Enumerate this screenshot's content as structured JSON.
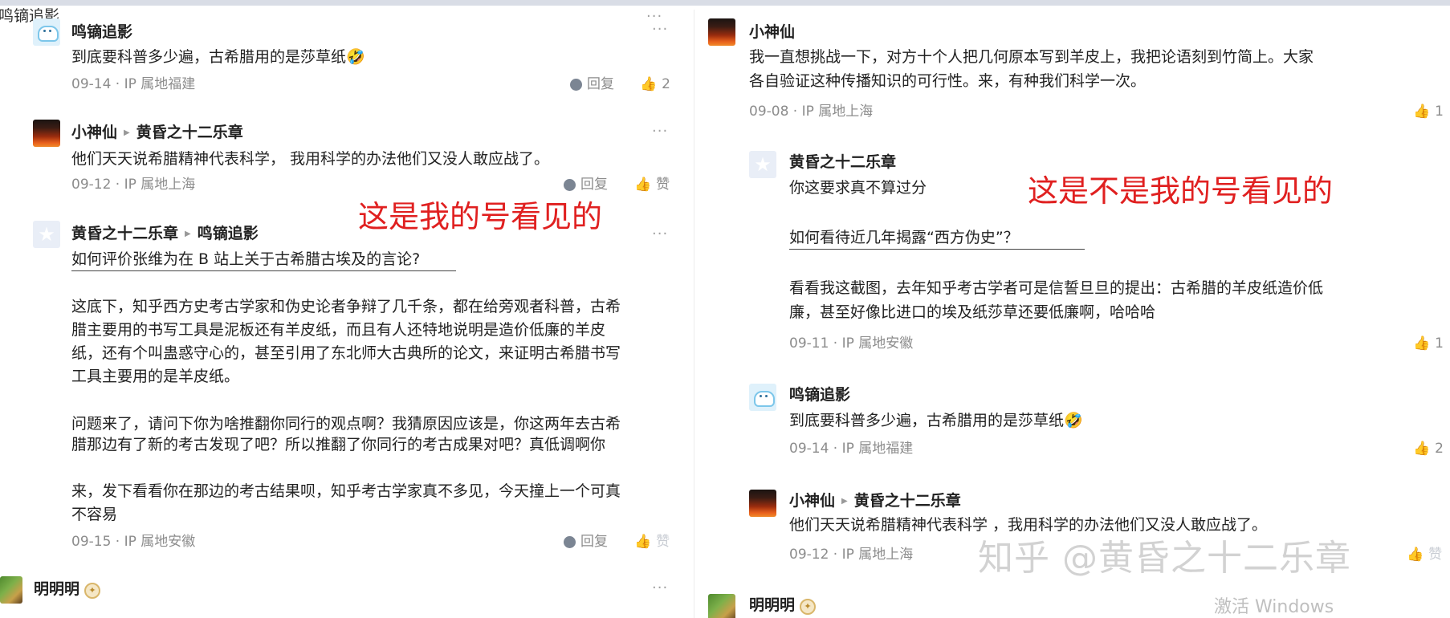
{
  "annotations": {
    "left": "这是我的号看见的",
    "right": "这是不是我的号看见的"
  },
  "watermark": "知乎 @黄昏之十二乐章",
  "windows_activate": "激活 Windows",
  "actions": {
    "reply": "回复",
    "like": "赞"
  },
  "left_panel": {
    "clipped_top_name": "鸣镝追影",
    "comments": [
      {
        "author": "鸣镝追影",
        "text": "到底要科普多少遍，古希腊用的是莎草纸🤣",
        "meta": "09-14 · IP 属地福建",
        "likes": "2"
      },
      {
        "author": "小神仙",
        "reply_to": "黄昏之十二乐章",
        "text": "他们天天说希腊精神代表科学， 我用科学的办法他们又没人敢应战了。",
        "meta": "09-12 · IP 属地上海"
      },
      {
        "author": "黄昏之十二乐章",
        "reply_to": "鸣镝追影",
        "link": "如何评价张维为在 B 站上关于古希腊古埃及的言论?",
        "paragraphs": [
          "这底下，知乎西方史考古学家和伪史论者争辩了几千条，都在给旁观者科普，古希",
          "腊主要用的书写工具是泥板还有羊皮纸，而且有人还特地说明是造价低廉的羊皮",
          "纸，还有个叫蛊惑守心的，甚至引用了东北师大古典所的论文，来证明古希腊书写",
          "工具主要用的是羊皮纸。",
          "问题来了，请问下你为啥推翻你同行的观点啊？我猜原因应该是，你这两年去古希",
          "腊那边有了新的考古发现了吧？所以推翻了你同行的考古成果对吧？真低调啊你",
          "来，发下看看你在那边的考古结果呗，知乎考古学家真不多见，今天撞上一个可真",
          "不容易"
        ],
        "meta": "09-15 · IP 属地安徽"
      },
      {
        "author": "明明明"
      }
    ]
  },
  "right_panel": {
    "comments": [
      {
        "author": "小神仙",
        "lines": [
          "我一直想挑战一下，对方十个人把几何原本写到羊皮上，我把论语刻到竹简上。大家",
          "各自验证这种传播知识的可行性。来，有种我们科学一次。"
        ],
        "meta": "09-08 · IP 属地上海",
        "likes": "1"
      },
      {
        "author": "黄昏之十二乐章",
        "text": "你这要求真不算过分",
        "link": "如何看待近几年揭露“西方伪史”？",
        "lines": [
          "看看我这截图，去年知乎考古学者可是信誓旦旦的提出：古希腊的羊皮纸造价低",
          "廉，甚至好像比进口的埃及纸莎草还要低廉啊，哈哈哈"
        ],
        "meta": "09-11 · IP 属地安徽",
        "likes": "1"
      },
      {
        "author": "鸣镝追影",
        "text": "到底要科普多少遍，古希腊用的是莎草纸🤣",
        "meta": "09-14 · IP 属地福建",
        "likes": "2"
      },
      {
        "author": "小神仙",
        "reply_to": "黄昏之十二乐章",
        "text": "他们天天说希腊精神代表科学 ，我用科学的办法他们又没人敢应战了。",
        "meta": "09-12 · IP 属地上海"
      },
      {
        "author": "明明明"
      }
    ]
  }
}
